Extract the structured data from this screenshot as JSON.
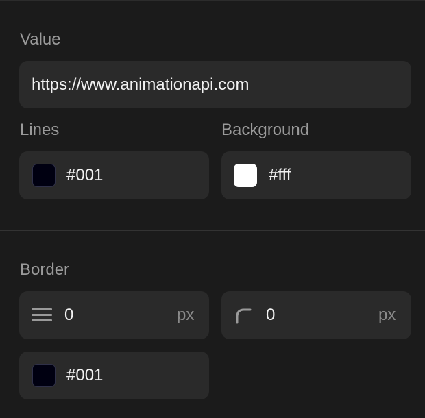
{
  "value": {
    "label": "Value",
    "url": "https://www.animationapi.com"
  },
  "lines": {
    "label": "Lines",
    "color_text": "#001",
    "color": "#000011"
  },
  "background": {
    "label": "Background",
    "color_text": "#fff",
    "color": "#ffffff"
  },
  "border": {
    "label": "Border",
    "width_value": "0",
    "width_unit": "px",
    "radius_value": "0",
    "radius_unit": "px",
    "color_text": "#001",
    "color": "#000011"
  }
}
